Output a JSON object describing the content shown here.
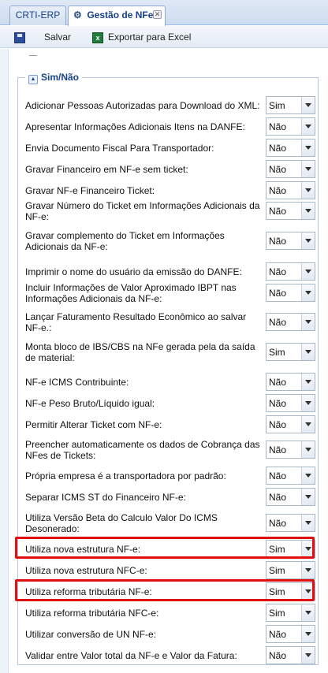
{
  "tabs": [
    {
      "label": "CRTI-ERP",
      "active": false
    },
    {
      "label": "Gestão de NFe",
      "active": true
    }
  ],
  "toolbar": {
    "save_label": "Salvar",
    "export_label": "Exportar para Excel"
  },
  "section": {
    "title": "Sim/Não"
  },
  "options": [
    "Sim",
    "Não"
  ],
  "settings": [
    {
      "label": "Adicionar Pessoas Autorizadas para Download do XML:",
      "value": "Sim"
    },
    {
      "label": "Apresentar Informações Adicionais Itens na DANFE:",
      "value": "Não"
    },
    {
      "label": "Envia Documento Fiscal Para Transportador:",
      "value": "Não"
    },
    {
      "label": "Gravar Financeiro em NF-e sem ticket:",
      "value": "Não"
    },
    {
      "label": "Gravar NF-e Financeiro Ticket:",
      "value": "Não"
    },
    {
      "label": "Gravar Número do Ticket em Informações Adicionais da NF-e:",
      "value": "Não"
    },
    {
      "label": "Gravar complemento do Ticket em Informações Adicionais da NF-e:",
      "value": "Não"
    },
    {
      "label": "Imprimir o nome do usuário da emissão do DANFE:",
      "value": "Não"
    },
    {
      "label": "Incluir Informações de Valor Aproximado IBPT nas Informações Adicionais da NF-e:",
      "value": "Não"
    },
    {
      "label": "Lançar Faturamento Resultado Econômico ao salvar NF-e.:",
      "value": "Não"
    },
    {
      "label": "Monta bloco de IBS/CBS na NFe gerada pela da saída de material:",
      "value": "Sim"
    },
    {
      "label": "NF-e ICMS Contribuinte:",
      "value": "Não"
    },
    {
      "label": "NF-e Peso Bruto/Líquido igual:",
      "value": "Não"
    },
    {
      "label": "Permitir Alterar Ticket com NF-e:",
      "value": "Não"
    },
    {
      "label": "Preencher automaticamente os dados de Cobrança das NFes de Tickets:",
      "value": "Não"
    },
    {
      "label": "Própria empresa é a transportadora por padrão:",
      "value": "Não"
    },
    {
      "label": "Separar ICMS ST do Financeiro NF-e:",
      "value": "Não"
    },
    {
      "label": "Utiliza Versão Beta do Calculo Valor Do ICMS Desonerado:",
      "value": "Não"
    },
    {
      "label": "Utiliza nova estrutura NF-e:",
      "value": "Sim",
      "highlighted": true
    },
    {
      "label": "Utiliza nova estrutura NFC-e:",
      "value": "Sim"
    },
    {
      "label": "Utiliza reforma tributária NF-e:",
      "value": "Sim",
      "highlighted": true
    },
    {
      "label": "Utiliza reforma tributária NFC-e:",
      "value": "Sim"
    },
    {
      "label": "Utilizar conversão de UN NF-e:",
      "value": "Não"
    },
    {
      "label": "Validar entre Valor total da NF-e e Valor da Fatura:",
      "value": "Não"
    }
  ],
  "colors": {
    "accent": "#15428b",
    "highlight": "#e01010"
  }
}
